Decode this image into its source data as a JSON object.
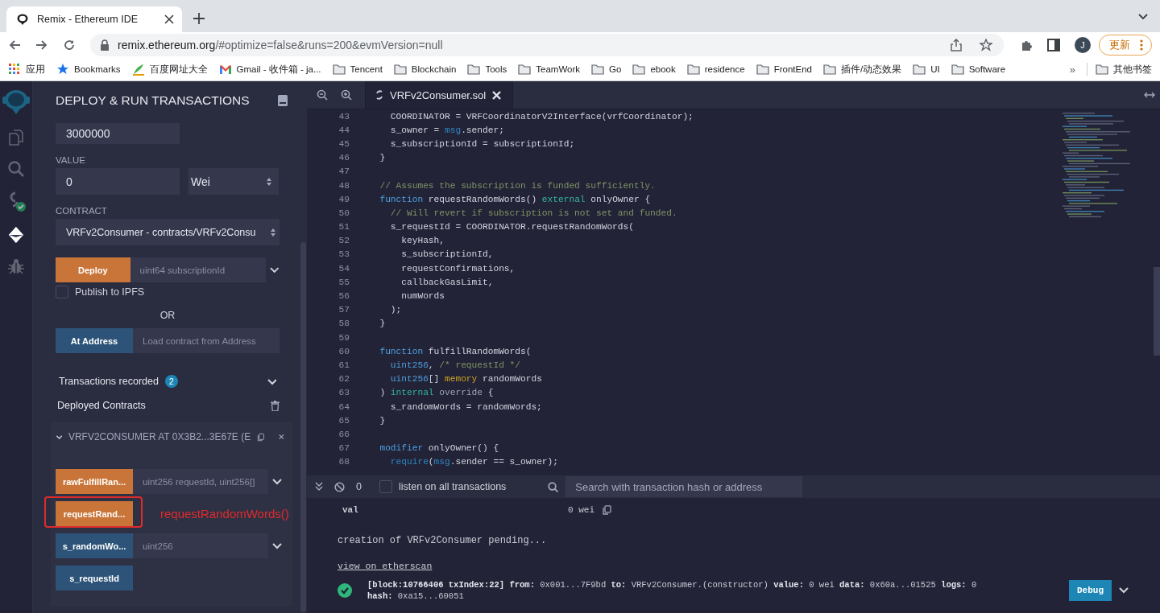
{
  "browser": {
    "tabs": [
      {
        "title": "Remix - Ethereum IDE",
        "selected": true
      }
    ],
    "url": {
      "host": "remix.ethereum.org",
      "path": "/#optimize=false&runs=200&evmVersion=null"
    },
    "profile_initial": "J",
    "update_button": "更新",
    "bookmarks": [
      {
        "label": "应用",
        "kind": "apps"
      },
      {
        "label": "Bookmarks",
        "kind": "star"
      },
      {
        "label": "百度网址大全",
        "kind": "hao"
      },
      {
        "label": "Gmail - 收件箱 - ja...",
        "kind": "mail"
      },
      {
        "label": "Tencent",
        "kind": "folder"
      },
      {
        "label": "Blockchain",
        "kind": "folder"
      },
      {
        "label": "Tools",
        "kind": "folder"
      },
      {
        "label": "TeamWork",
        "kind": "folder"
      },
      {
        "label": "Go",
        "kind": "folder"
      },
      {
        "label": "ebook",
        "kind": "folder"
      },
      {
        "label": "residence",
        "kind": "folder"
      },
      {
        "label": "FrontEnd",
        "kind": "folder"
      },
      {
        "label": "插件/动态效果",
        "kind": "folder"
      },
      {
        "label": "UI",
        "kind": "folder"
      },
      {
        "label": "Software",
        "kind": "folder"
      }
    ],
    "overflow": "»",
    "other_bookmarks": "其他书签"
  },
  "icon_bar": [
    {
      "kind": "logo",
      "selected": false
    },
    {
      "kind": "files",
      "selected": false
    },
    {
      "kind": "search",
      "selected": false
    },
    {
      "kind": "compiler",
      "selected": false
    },
    {
      "kind": "deploy",
      "selected": true
    },
    {
      "kind": "debugger",
      "selected": false
    }
  ],
  "panel": {
    "title": "DEPLOY & RUN TRANSACTIONS",
    "gas_limit": "3000000",
    "value_label": "VALUE",
    "value": "0",
    "unit": "Wei",
    "contract_label": "CONTRACT",
    "contract": "VRFv2Consumer - contracts/VRFv2Consu",
    "deploy": {
      "label": "Deploy",
      "placeholder": "uint64 subscriptionId"
    },
    "publish": {
      "label": "Publish to IPFS",
      "checked": false
    },
    "or_text": "OR",
    "at_address": {
      "label": "At Address",
      "placeholder": "Load contract from Address"
    },
    "transactions": {
      "label": "Transactions recorded",
      "count": "2"
    },
    "deployed_label": "Deployed Contracts",
    "instance": {
      "title": "VRFV2CONSUMER AT 0X3B2...3E67E (E",
      "functions": [
        {
          "label": "rawFulfillRan...",
          "kind": "transact",
          "placeholder": "uint256 requestId, uint256[]"
        },
        {
          "label": "requestRand...",
          "kind": "transact",
          "annotation": "requestRandomWords()"
        },
        {
          "label": "s_randomWo...",
          "kind": "call",
          "placeholder": "uint256"
        },
        {
          "label": "s_requestId",
          "kind": "call"
        }
      ]
    }
  },
  "editor": {
    "tab": {
      "title": "VRFv2Consumer.sol"
    },
    "lines": [
      {
        "n": "43",
        "code": [
          {
            "kind": "plain",
            "text": "    COORDINATOR = VRFCoordinatorV2Interface(vrfCoordinator);"
          }
        ]
      },
      {
        "n": "44",
        "code": [
          {
            "kind": "plain",
            "text": "    s_owner = "
          },
          {
            "kind": "global",
            "text": "msg"
          },
          {
            "kind": "plain",
            "text": ".sender;"
          }
        ]
      },
      {
        "n": "45",
        "code": [
          {
            "kind": "plain",
            "text": "    s_subscriptionId = subscriptionId;"
          }
        ]
      },
      {
        "n": "46",
        "code": [
          {
            "kind": "plain",
            "text": "  }"
          }
        ]
      },
      {
        "n": "47"
      },
      {
        "n": "48",
        "code": [
          {
            "kind": "comment",
            "text": "  // Assumes the subscription is funded sufficiently."
          }
        ]
      },
      {
        "n": "49",
        "code": [
          {
            "kind": "keyword",
            "text": "  function"
          },
          {
            "kind": "plain",
            "text": " requestRandomWords() "
          },
          {
            "kind": "visibility",
            "text": "external"
          },
          {
            "kind": "plain",
            "text": " onlyOwner {"
          }
        ]
      },
      {
        "n": "50",
        "code": [
          {
            "kind": "comment",
            "text": "    // Will revert if subscription is not set and funded."
          }
        ]
      },
      {
        "n": "51",
        "code": [
          {
            "kind": "plain",
            "text": "    s_requestId = COORDINATOR.requestRandomWords("
          }
        ]
      },
      {
        "n": "52",
        "code": [
          {
            "kind": "plain",
            "text": "      keyHash,"
          }
        ]
      },
      {
        "n": "53",
        "code": [
          {
            "kind": "plain",
            "text": "      s_subscriptionId,"
          }
        ]
      },
      {
        "n": "54",
        "code": [
          {
            "kind": "plain",
            "text": "      requestConfirmations,"
          }
        ]
      },
      {
        "n": "55",
        "code": [
          {
            "kind": "plain",
            "text": "      callbackGasLimit,"
          }
        ]
      },
      {
        "n": "56",
        "code": [
          {
            "kind": "plain",
            "text": "      numWords"
          }
        ]
      },
      {
        "n": "57",
        "code": [
          {
            "kind": "plain",
            "text": "    );"
          }
        ]
      },
      {
        "n": "58",
        "code": [
          {
            "kind": "plain",
            "text": "  }"
          }
        ]
      },
      {
        "n": "59"
      },
      {
        "n": "60",
        "code": [
          {
            "kind": "keyword",
            "text": "  function"
          },
          {
            "kind": "plain",
            "text": " fulfillRandomWords("
          }
        ]
      },
      {
        "n": "61",
        "code": [
          {
            "kind": "type",
            "text": "    uint256"
          },
          {
            "kind": "plain",
            "text": ", "
          },
          {
            "kind": "comment",
            "text": "/* requestId */"
          }
        ]
      },
      {
        "n": "62",
        "code": [
          {
            "kind": "type",
            "text": "    uint256"
          },
          {
            "kind": "plain",
            "text": "[] "
          },
          {
            "kind": "location",
            "text": "memory"
          },
          {
            "kind": "plain",
            "text": " randomWords"
          }
        ]
      },
      {
        "n": "63",
        "code": [
          {
            "kind": "plain",
            "text": "  ) "
          },
          {
            "kind": "visibility",
            "text": "internal"
          },
          {
            "kind": "modifier",
            "text": " override"
          },
          {
            "kind": "plain",
            "text": " {"
          }
        ]
      },
      {
        "n": "64",
        "code": [
          {
            "kind": "plain",
            "text": "    s_randomWords = randomWords;"
          }
        ]
      },
      {
        "n": "65",
        "code": [
          {
            "kind": "plain",
            "text": "  }"
          }
        ]
      },
      {
        "n": "66"
      },
      {
        "n": "67",
        "code": [
          {
            "kind": "keyword",
            "text": "  modifier"
          },
          {
            "kind": "plain",
            "text": " onlyOwner() {"
          }
        ]
      },
      {
        "n": "68",
        "code": [
          {
            "kind": "global",
            "text": "    require"
          },
          {
            "kind": "plain",
            "text": "("
          },
          {
            "kind": "global",
            "text": "msg"
          },
          {
            "kind": "plain",
            "text": ".sender == s_owner);"
          }
        ]
      }
    ]
  },
  "terminal": {
    "pending_count": "0",
    "listen": {
      "label": "listen on all transactions",
      "checked": false
    },
    "search_placeholder": "Search with transaction hash or address",
    "log": [
      {
        "kind": "field",
        "key": "val",
        "value": "0 wei"
      },
      {
        "kind": "text",
        "text": "creation of VRFv2Consumer pending..."
      },
      {
        "kind": "link",
        "text": "view on etherscan"
      },
      {
        "kind": "tx",
        "succeeded": true,
        "line1": "**[block:10766406 txIndex:22]** **from:** 0x001...7F9bd **to:** VRFv2Consumer.(constructor) **value:** 0 wei **data:** 0x60a...01525 **logs:** 0",
        "line2": "**hash:** 0xa15...60051",
        "button": "Debug"
      }
    ]
  }
}
